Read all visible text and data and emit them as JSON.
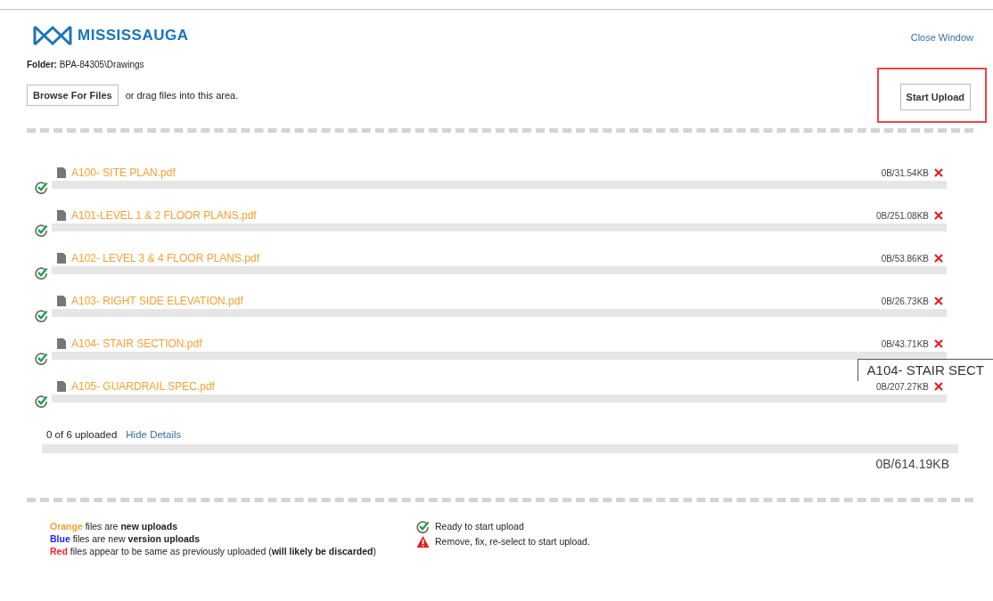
{
  "header": {
    "logo_text": "MISSISSAUGA",
    "close_link": "Close Window"
  },
  "folder": {
    "label": "Folder:",
    "path": "BPA-84305\\Drawings"
  },
  "browse_button": "Browse For Files",
  "drag_hint": "or drag files into this area.",
  "start_button": {
    "label": "Start Upload",
    "highlighted": true
  },
  "files": [
    {
      "name": "A100- SITE PLAN.pdf",
      "size": "0B/31.54KB",
      "color": "#f7a030",
      "kind": "ready",
      "level": 0
    },
    {
      "name": "A101-LEVEL 1 & 2 FLOOR PLANS.pdf",
      "size": "0B/251.08KB",
      "color": "#f7a030",
      "kind": "ready",
      "level": 0
    },
    {
      "name": "A102- LEVEL 3 & 4 FLOOR PLANS.pdf",
      "size": "0B/53.86KB",
      "color": "#f7a030",
      "kind": "ready",
      "level": 0
    },
    {
      "name": "A103- RIGHT SIDE ELEVATION.pdf",
      "size": "0B/26.73KB",
      "color": "#f7a030",
      "kind": "ready",
      "level": 0
    },
    {
      "name": "A104- STAIR SECTION.pdf",
      "size": "0B/43.71KB",
      "color": "#f7a030",
      "kind": "ready",
      "level": 0
    },
    {
      "name": "A105- GUARDRAIL SPEC.pdf",
      "size": "0B/207.27KB",
      "color": "#f7a030",
      "kind": "ready",
      "level": 0
    }
  ],
  "tooltip": "A104- STAIR SECT",
  "summary": {
    "count": "0 of 6 uploaded",
    "toggle_link": "Hide Details",
    "level": 0,
    "total": "0B/614.19KB"
  },
  "legend": [
    {
      "color_word": "Orange",
      "color": "#f7a030",
      "text": " files are **new uploads**"
    },
    {
      "color_word": "Blue",
      "color": "#2222ff",
      "text": " files are new **version uploads**"
    },
    {
      "color_word": "Red",
      "color": "#ff2222",
      "text": " files appear to be same as previously uploaded (**will likely be discarded**)"
    }
  ],
  "status_legend": [
    {
      "kind": "ready",
      "text": "Ready to start upload"
    },
    {
      "kind": "error",
      "text": "Remove, fix, re-select to start upload."
    }
  ]
}
